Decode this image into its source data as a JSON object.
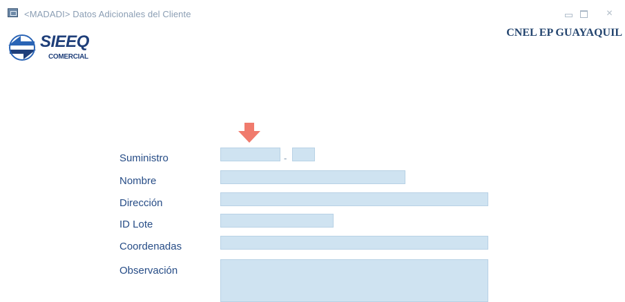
{
  "window": {
    "title": "<MADADI> Datos Adicionales del Cliente",
    "company": "CNEL EP GUAYAQUIL",
    "controls": [
      "minimize-icon",
      "maximize-icon",
      "close-icon"
    ]
  },
  "logo": {
    "name": "SIEEQ",
    "subtitle": "COMERCIAL"
  },
  "marker": {
    "icon": "down-arrow-icon",
    "color": "#f07b6d"
  },
  "form": {
    "suministro": {
      "label": "Suministro",
      "separator": "-"
    },
    "nombre": {
      "label": "Nombre"
    },
    "direccion": {
      "label": "Dirección"
    },
    "id_lote": {
      "label": "ID Lote"
    },
    "coordenadas": {
      "label": "Coordenadas"
    },
    "observacion": {
      "label": "Observación"
    }
  },
  "colors": {
    "label_text": "#264c86",
    "field_fill": "#cfe3f1",
    "title_text": "#8a9db3",
    "logo_blue": "#1f3f7a"
  }
}
